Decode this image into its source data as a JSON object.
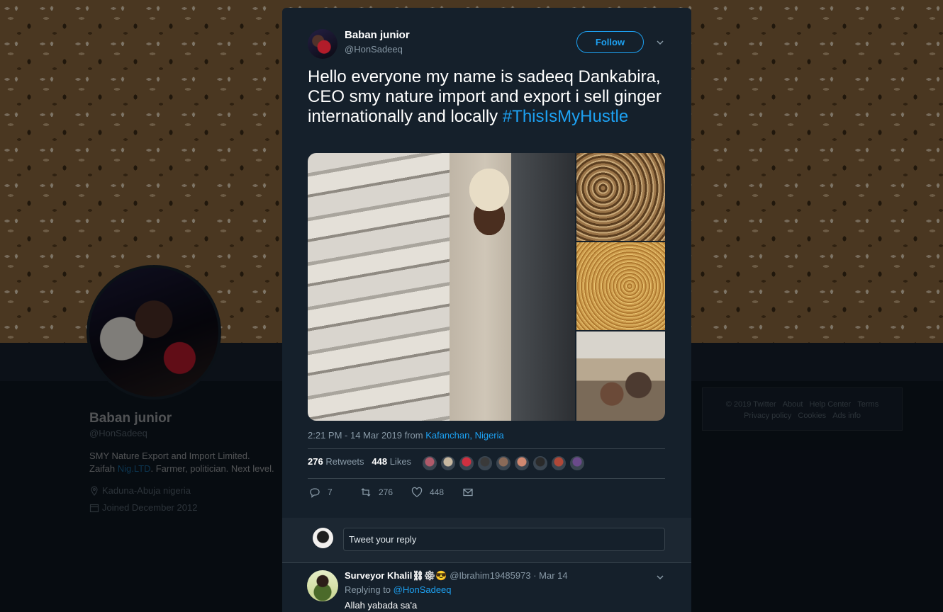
{
  "profile": {
    "name": "Baban junior",
    "handle": "@HonSadeeq",
    "bio_line1": "SMY Nature Export and Import Limited.",
    "bio_line2_pre": "Zaifah ",
    "bio_link": "Nig.LTD",
    "bio_line2_post": ". Farmer, politician. Next level.",
    "location": "Kaduna-Abuja nigeria",
    "joined": "Joined December 2012"
  },
  "footer": {
    "links_row1": [
      "© 2019 Twitter",
      "About",
      "Help Center",
      "Terms"
    ],
    "links_row2": [
      "Privacy policy",
      "Cookies",
      "Ads info"
    ]
  },
  "tweet": {
    "author_name": "Baban junior",
    "author_handle": "@HonSadeeq",
    "follow_label": "Follow",
    "text": "Hello everyone my name is sadeeq Dankabira, CEO smy nature import and export i sell ginger internationally and locally ",
    "hashtag": "#ThisIsMyHustle",
    "time": "2:21 PM - 14 Mar 2019 from ",
    "location": "Kafanchan, Nigeria",
    "retweets_count": "276",
    "retweets_label": "Retweets",
    "likes_count": "448",
    "likes_label": "Likes",
    "reply_count": "7",
    "retweet_action_count": "276",
    "like_action_count": "448"
  },
  "likers_colors": [
    "#b05a6a",
    "#c8b8a0",
    "#d03040",
    "#3a3a3a",
    "#8a6a58",
    "#d08870",
    "#2a2a2a",
    "#b04838",
    "#6a4a8a"
  ],
  "reply_box": {
    "placeholder": "Tweet your reply"
  },
  "reply": {
    "author_name": "Surveyor Khalil⛓⚙😎",
    "author_handle": "@Ibrahim19485973",
    "date": "· Mar 14",
    "replying_label": "Replying to ",
    "replying_to": "@HonSadeeq",
    "text": "Allah yabada sa'a"
  }
}
